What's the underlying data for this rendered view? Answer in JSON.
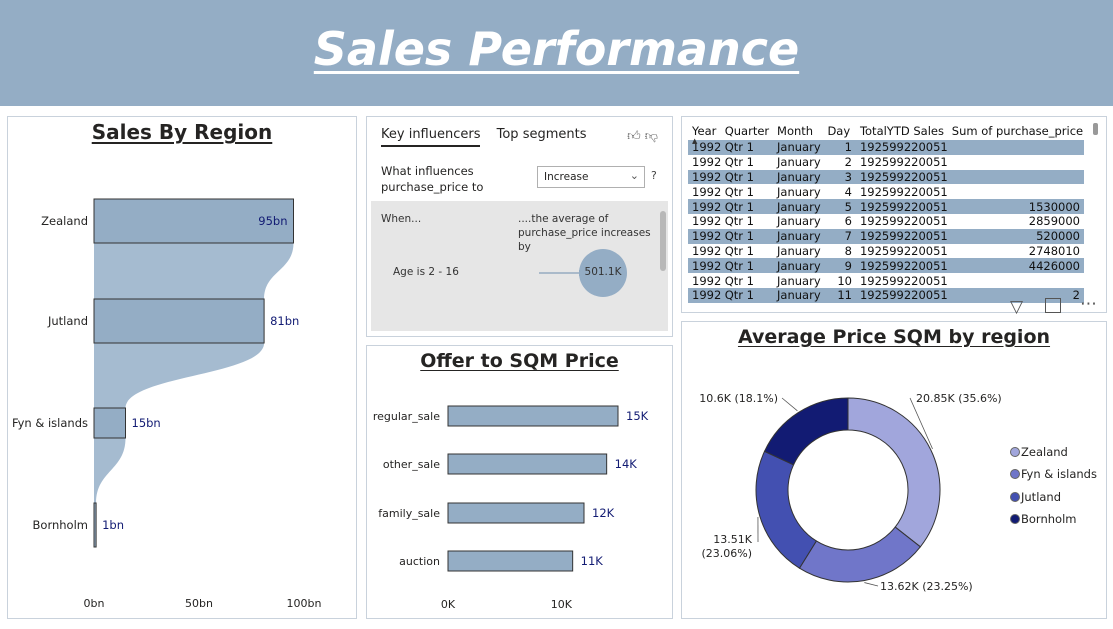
{
  "header": {
    "title": "Sales Performance"
  },
  "sales_by_region": {
    "title": "Sales By Region",
    "chart_data": {
      "type": "bar",
      "title": "Sales By Region",
      "categories": [
        "Zealand",
        "Jutland",
        "Fyn & islands",
        "Bornholm"
      ],
      "values": [
        95,
        81,
        15,
        1
      ],
      "value_labels": [
        "95bn",
        "81bn",
        "15bn",
        "1bn"
      ],
      "xlim": [
        0,
        100
      ],
      "x_ticks": [
        "0bn",
        "50bn",
        "100bn"
      ]
    }
  },
  "key_influencers": {
    "tab_key": "Key influencers",
    "tab_top": "Top segments",
    "question": "What influences purchase_price to",
    "select_value": "Increase",
    "help": "?",
    "when_label": "When...",
    "avg_label": "....the average of purchase_price increases by",
    "factor": "Age is 2 - 16",
    "factor_value": "501.1K"
  },
  "table": {
    "columns": [
      "Year",
      "Quarter",
      "Month",
      "Day",
      "TotalYTD Sales",
      "Sum of purchase_price"
    ],
    "rows": [
      [
        "1992",
        "Qtr 1",
        "January",
        "1",
        "192599220051",
        ""
      ],
      [
        "1992",
        "Qtr 1",
        "January",
        "2",
        "192599220051",
        ""
      ],
      [
        "1992",
        "Qtr 1",
        "January",
        "3",
        "192599220051",
        ""
      ],
      [
        "1992",
        "Qtr 1",
        "January",
        "4",
        "192599220051",
        ""
      ],
      [
        "1992",
        "Qtr 1",
        "January",
        "5",
        "192599220051",
        "1530000"
      ],
      [
        "1992",
        "Qtr 1",
        "January",
        "6",
        "192599220051",
        "2859000"
      ],
      [
        "1992",
        "Qtr 1",
        "January",
        "7",
        "192599220051",
        "520000"
      ],
      [
        "1992",
        "Qtr 1",
        "January",
        "8",
        "192599220051",
        "2748010"
      ],
      [
        "1992",
        "Qtr 1",
        "January",
        "9",
        "192599220051",
        "4426000"
      ],
      [
        "1992",
        "Qtr 1",
        "January",
        "10",
        "192599220051",
        ""
      ],
      [
        "1992",
        "Qtr 1",
        "January",
        "11",
        "192599220051",
        "2"
      ]
    ]
  },
  "offer_to_sqm": {
    "title": "Offer to SQM Price",
    "chart_data": {
      "type": "bar",
      "title": "Offer to SQM Price",
      "categories": [
        "regular_sale",
        "other_sale",
        "family_sale",
        "auction"
      ],
      "values": [
        15,
        14,
        12,
        11
      ],
      "value_labels": [
        "15K",
        "14K",
        "12K",
        "11K"
      ],
      "xlim": [
        0,
        15
      ],
      "x_ticks": [
        "0K",
        "10K"
      ]
    }
  },
  "avg_price_sqm": {
    "title": "Average Price SQM by region",
    "chart_data": {
      "type": "pie",
      "title": "Average Price SQM by region",
      "categories": [
        "Zealand",
        "Fyn & islands",
        "Jutland",
        "Bornholm"
      ],
      "values": [
        20.85,
        13.62,
        13.51,
        10.6
      ],
      "percents": [
        35.6,
        23.25,
        23.06,
        18.1
      ],
      "labels": [
        "20.85K (35.6%)",
        "13.62K (23.25%)",
        "13.51K (23.06%)",
        "10.6K (18.1%)"
      ],
      "colors": [
        "#a1a6dc",
        "#7076c9",
        "#4350b1",
        "#121b73"
      ]
    }
  },
  "colors": {
    "header": "#94adc5",
    "bar": "#94adc5",
    "highlight": "#94adc5"
  }
}
